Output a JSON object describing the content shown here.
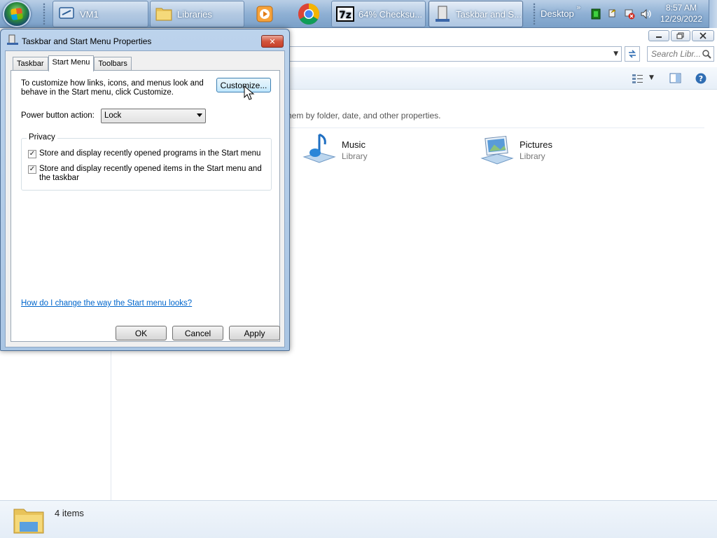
{
  "taskbar": {
    "buttons": [
      {
        "label": "VM1"
      },
      {
        "label": "Libraries"
      },
      {
        "label": "64% Checksu..."
      },
      {
        "label": "Taskbar and S..."
      }
    ],
    "desktop_label": "Desktop",
    "overflow_chevron": "»",
    "clock": {
      "time": "8:57 AM",
      "date": "12/29/2022"
    }
  },
  "explorer": {
    "search_placeholder": "Search Libr...",
    "library_description": "hem by folder, date, and other properties.",
    "libraries": [
      {
        "name": "Music",
        "type": "Library"
      },
      {
        "name": "Pictures",
        "type": "Library"
      }
    ],
    "status": {
      "items_count": "4 items"
    }
  },
  "dialog": {
    "title": "Taskbar and Start Menu Properties",
    "close_glyph": "✕",
    "tabs": [
      {
        "label": "Taskbar",
        "selected": false
      },
      {
        "label": "Start Menu",
        "selected": true
      },
      {
        "label": "Toolbars",
        "selected": false
      }
    ],
    "intro_text": "To customize how links, icons, and menus look and behave in the Start menu, click Customize.",
    "customize_label": "Customize...",
    "power_button_label": "Power button action:",
    "power_button_value": "Lock",
    "privacy": {
      "title": "Privacy",
      "options": [
        {
          "label": "Store and display recently opened programs in the Start menu",
          "checked": true
        },
        {
          "label": "Store and display recently opened items in the Start menu and the taskbar",
          "checked": true
        }
      ]
    },
    "help_link": "How do I change the way the Start menu looks?",
    "buttons": {
      "ok": "OK",
      "cancel": "Cancel",
      "apply": "Apply"
    }
  },
  "colors": {
    "taskbar": "#8fb0d4",
    "dialog_frame": "#a9c5e3",
    "link": "#0066cc",
    "close_button": "#d3543c"
  }
}
